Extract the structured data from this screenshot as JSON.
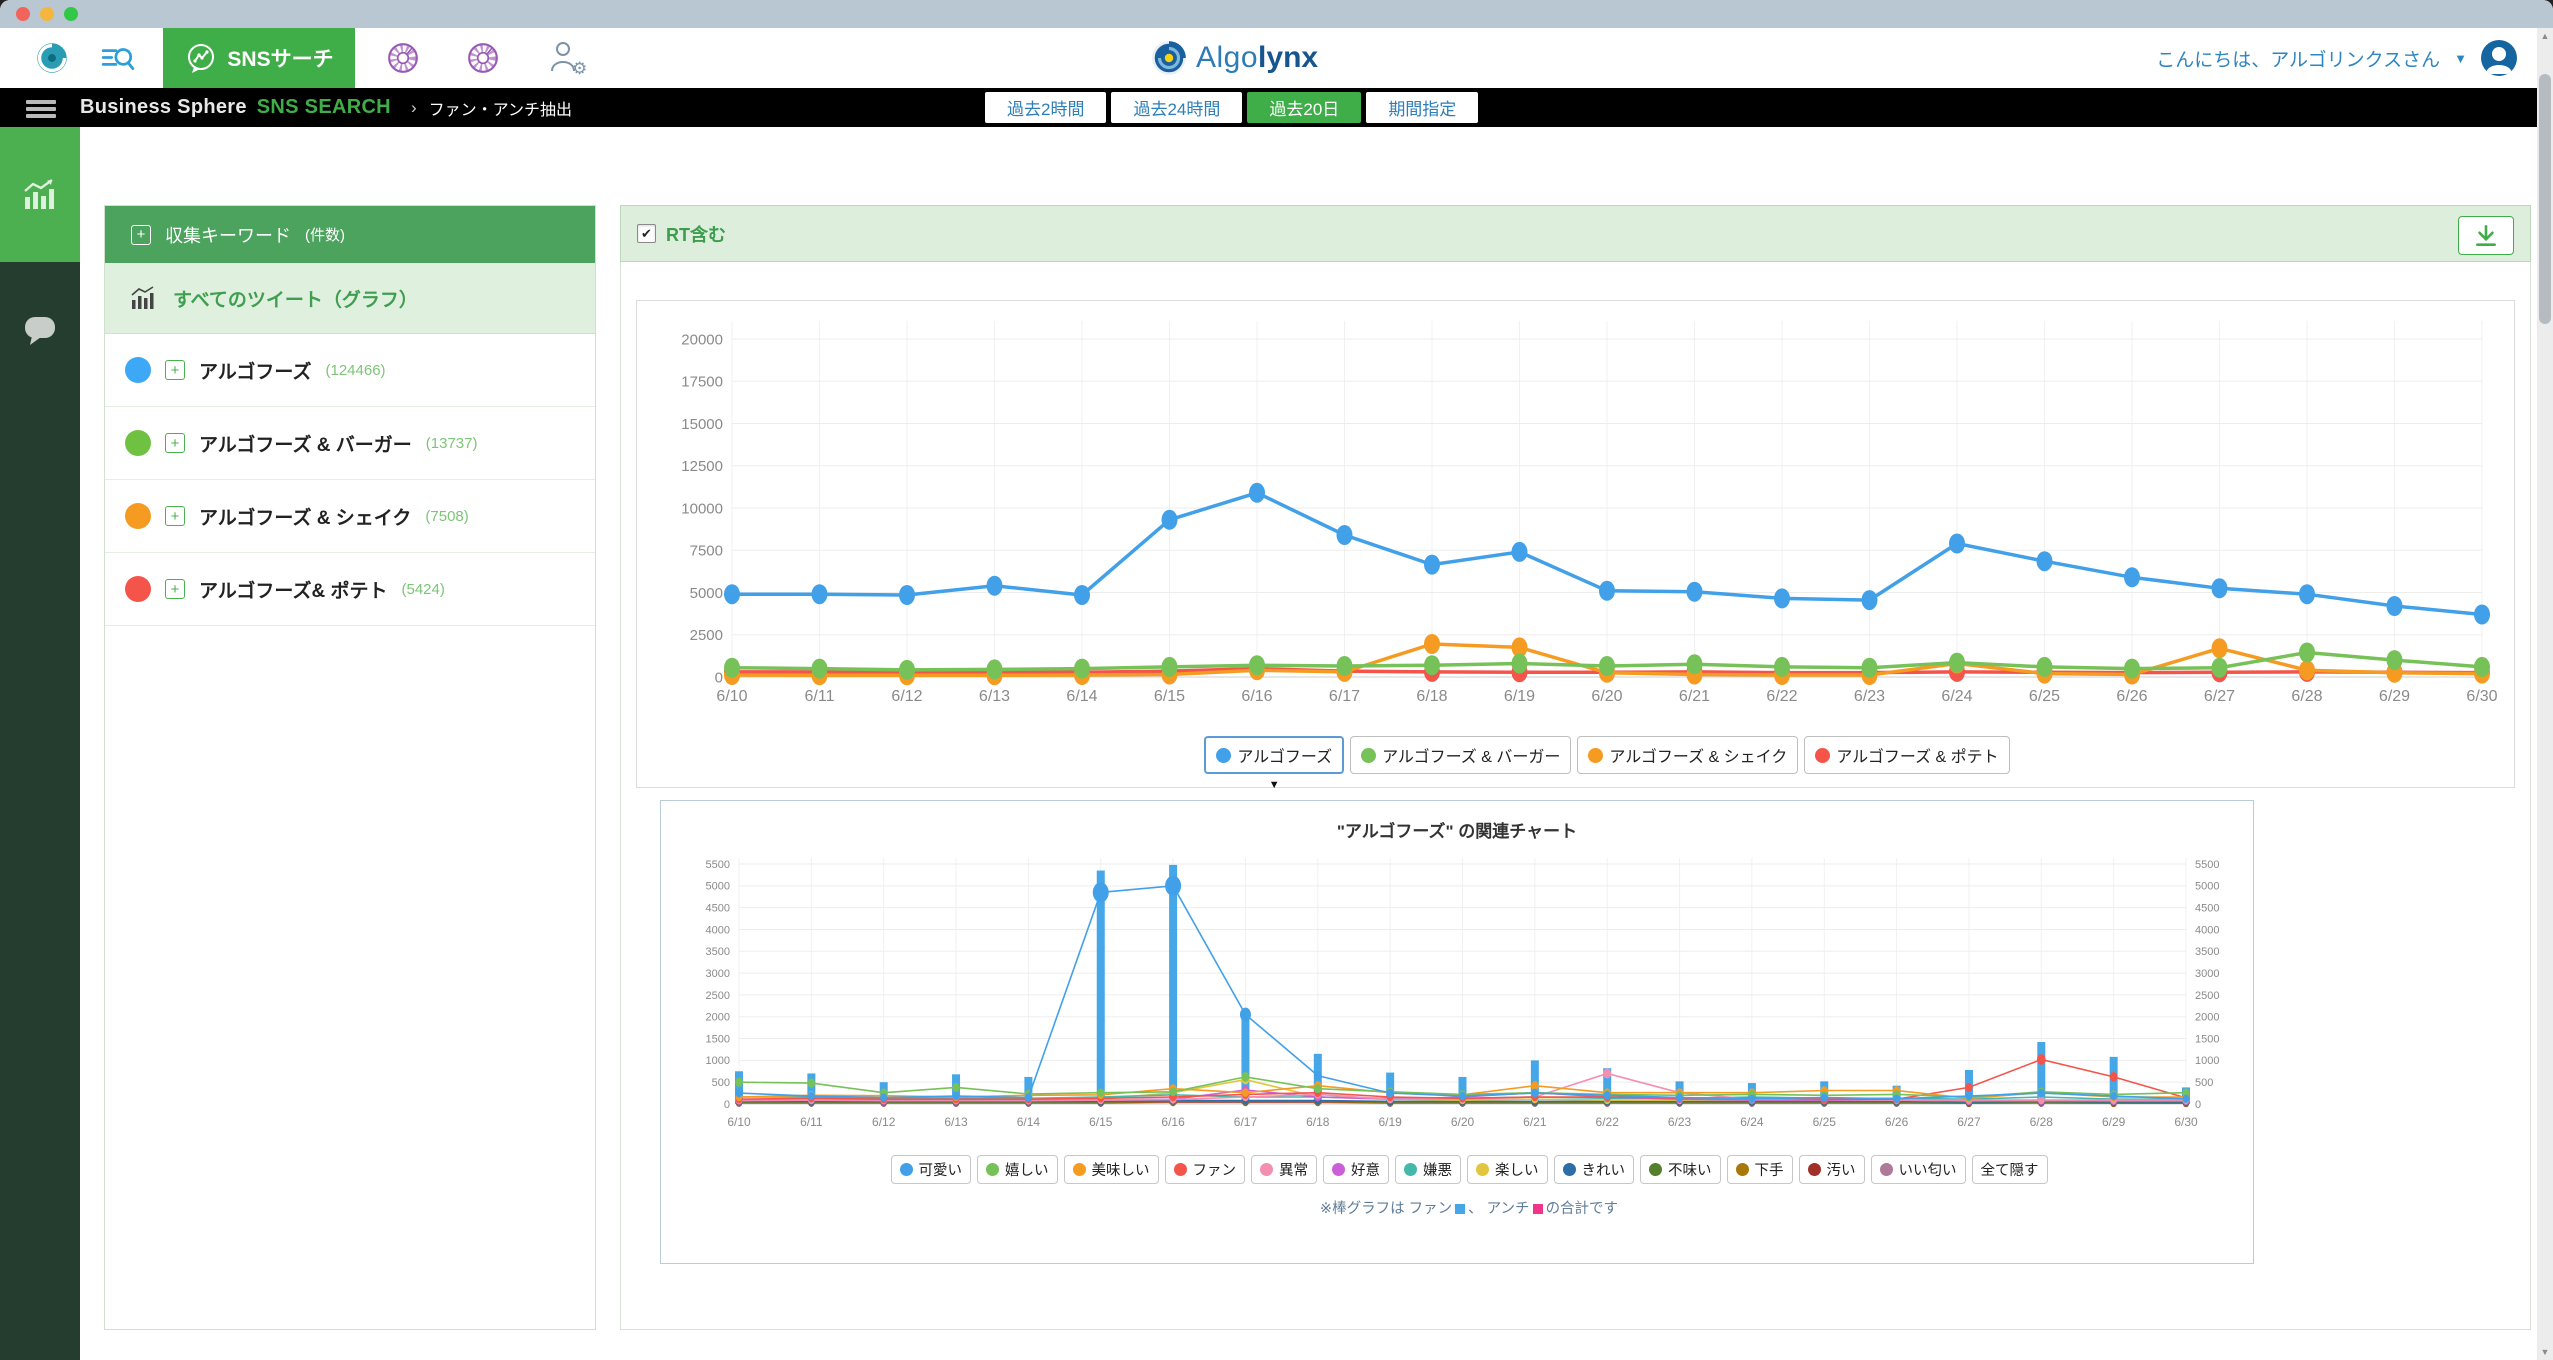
{
  "icons": {
    "plus": "+",
    "check": "✔",
    "caret_down": "▼",
    "scroll_up": "▲",
    "scroll_down": "▼",
    "selected_marker": "▼"
  },
  "navbar": {
    "tab_label": "SNSサーチ",
    "logo_algo": "Algo",
    "logo_lynx": "lynx",
    "greeting": "こんにちは、アルゴリンクスさん"
  },
  "blackbar": {
    "brand_left": "Business Sphere",
    "brand_right": "SNS SEARCH",
    "crumb_sep": "›",
    "breadcrumb": "ファン・アンチ抽出",
    "time_buttons": [
      {
        "label": "過去2時間",
        "active": false
      },
      {
        "label": "過去24時間",
        "active": false
      },
      {
        "label": "過去20日",
        "active": true
      },
      {
        "label": "期間指定",
        "active": false
      }
    ]
  },
  "sidebar": {
    "header_label": "収集キーワード",
    "header_suffix": "(件数)",
    "all_tweets_label": "すべてのツイート（グラフ）",
    "keywords": [
      {
        "label": "アルゴフーズ",
        "count": "(124466)",
        "color": "#3da8f5"
      },
      {
        "label": "アルゴフーズ & バーガー",
        "count": "(13737)",
        "color": "#6fc142"
      },
      {
        "label": "アルゴフーズ & シェイク",
        "count": "(7508)",
        "color": "#f59b22"
      },
      {
        "label": "アルゴフーズ& ポテト",
        "count": "(5424)",
        "color": "#f4544a"
      }
    ]
  },
  "toolbar": {
    "rt_label": "RT含む",
    "rt_checked": true
  },
  "colors": {
    "accent_green": "#3fae49",
    "link_blue": "#2e86c1",
    "fan_square": "#45a7e8",
    "anti_square": "#f0368b"
  },
  "chart_data": [
    {
      "type": "line",
      "title": "",
      "categories": [
        "6/10",
        "6/11",
        "6/12",
        "6/13",
        "6/14",
        "6/15",
        "6/16",
        "6/17",
        "6/18",
        "6/19",
        "6/20",
        "6/21",
        "6/22",
        "6/23",
        "6/24",
        "6/25",
        "6/26",
        "6/27",
        "6/28",
        "6/29",
        "6/30"
      ],
      "ylim": [
        0,
        20000
      ],
      "ystep": 2500,
      "legend_position": "bottom",
      "grid": true,
      "series": [
        {
          "name": "アルゴフーズ",
          "color": "#41a0e8",
          "selected": true,
          "values": [
            4900,
            4900,
            4850,
            5400,
            4850,
            9300,
            10900,
            8400,
            6650,
            7400,
            5100,
            5050,
            4650,
            4550,
            7900,
            6850,
            5900,
            5250,
            4900,
            4200,
            3700
          ]
        },
        {
          "name": "アルゴフーズ & バーガー",
          "color": "#77c159",
          "selected": false,
          "values": [
            550,
            500,
            420,
            450,
            500,
            600,
            700,
            650,
            700,
            800,
            650,
            750,
            600,
            550,
            850,
            600,
            500,
            550,
            1450,
            1000,
            600
          ]
        },
        {
          "name": "アルゴフーズ & シェイク",
          "color": "#f59b22",
          "selected": false,
          "values": [
            120,
            100,
            100,
            100,
            120,
            150,
            400,
            300,
            1950,
            1750,
            250,
            150,
            120,
            120,
            800,
            200,
            150,
            1700,
            400,
            250,
            200
          ]
        },
        {
          "name": "アルゴフーズ & ポテト",
          "color": "#f4544a",
          "selected": false,
          "values": [
            300,
            300,
            300,
            280,
            280,
            350,
            500,
            350,
            300,
            280,
            280,
            300,
            260,
            260,
            300,
            280,
            260,
            280,
            300,
            280,
            260
          ]
        }
      ]
    },
    {
      "type": "bar+line",
      "title": "\"アルゴフーズ\" の関連チャート",
      "categories": [
        "6/10",
        "6/11",
        "6/12",
        "6/13",
        "6/14",
        "6/15",
        "6/16",
        "6/17",
        "6/18",
        "6/19",
        "6/20",
        "6/21",
        "6/22",
        "6/23",
        "6/24",
        "6/25",
        "6/26",
        "6/27",
        "6/28",
        "6/29",
        "6/30"
      ],
      "ylim": [
        0,
        5500
      ],
      "ystep": 500,
      "grid": true,
      "legend_position": "bottom",
      "bars": {
        "name": "ファン・アンチ合計",
        "color": "#45a7e8",
        "values": [
          750,
          700,
          500,
          680,
          620,
          5350,
          5480,
          2050,
          1150,
          720,
          620,
          1000,
          820,
          520,
          480,
          520,
          420,
          780,
          1420,
          1080,
          380
        ]
      },
      "series": [
        {
          "name": "可愛い",
          "color": "#41a0e8",
          "values": [
            250,
            180,
            150,
            180,
            150,
            4850,
            5000,
            2050,
            650,
            250,
            180,
            250,
            200,
            150,
            120,
            150,
            120,
            180,
            250,
            180,
            120
          ]
        },
        {
          "name": "嬉しい",
          "color": "#77c159",
          "values": [
            500,
            480,
            260,
            380,
            230,
            260,
            280,
            620,
            350,
            280,
            220,
            260,
            220,
            200,
            220,
            200,
            220,
            160,
            280,
            220,
            260
          ]
        },
        {
          "name": "美味しい",
          "color": "#f59b22",
          "values": [
            160,
            200,
            190,
            160,
            200,
            210,
            350,
            260,
            420,
            260,
            210,
            420,
            260,
            260,
            260,
            310,
            310,
            130,
            260,
            160,
            160
          ]
        },
        {
          "name": "ファン",
          "color": "#f4544a",
          "values": [
            110,
            130,
            110,
            110,
            110,
            130,
            160,
            220,
            260,
            160,
            130,
            160,
            160,
            140,
            130,
            110,
            110,
            380,
            1020,
            620,
            140
          ]
        },
        {
          "name": "異常",
          "color": "#f48fb1",
          "values": [
            90,
            90,
            90,
            90,
            90,
            90,
            100,
            160,
            220,
            110,
            110,
            160,
            700,
            260,
            110,
            110,
            90,
            90,
            90,
            90,
            90
          ]
        },
        {
          "name": "好意",
          "color": "#cb5fd6",
          "values": [
            70,
            90,
            70,
            70,
            70,
            90,
            110,
            320,
            160,
            110,
            160,
            260,
            160,
            110,
            90,
            90,
            90,
            70,
            70,
            70,
            70
          ]
        },
        {
          "name": "嫌悪",
          "color": "#45b8ac",
          "values": [
            160,
            160,
            130,
            130,
            130,
            160,
            210,
            160,
            160,
            130,
            130,
            160,
            130,
            130,
            160,
            130,
            130,
            110,
            160,
            110,
            110
          ]
        },
        {
          "name": "楽しい",
          "color": "#e3c63e",
          "values": [
            90,
            90,
            90,
            90,
            90,
            110,
            260,
            560,
            160,
            110,
            90,
            110,
            90,
            90,
            90,
            90,
            90,
            70,
            90,
            70,
            70
          ]
        },
        {
          "name": "きれい",
          "color": "#2d6da8",
          "values": [
            60,
            60,
            60,
            60,
            60,
            60,
            80,
            80,
            80,
            60,
            60,
            60,
            60,
            60,
            60,
            60,
            60,
            50,
            60,
            50,
            50
          ]
        },
        {
          "name": "不味い",
          "color": "#557f2d",
          "values": [
            50,
            50,
            50,
            50,
            50,
            50,
            70,
            70,
            70,
            50,
            50,
            50,
            50,
            50,
            50,
            50,
            50,
            40,
            50,
            40,
            40
          ]
        },
        {
          "name": "下手",
          "color": "#a8790a",
          "values": [
            40,
            40,
            40,
            40,
            40,
            40,
            60,
            60,
            60,
            40,
            40,
            40,
            40,
            40,
            40,
            40,
            40,
            30,
            40,
            30,
            30
          ]
        },
        {
          "name": "汚い",
          "color": "#a03028",
          "values": [
            30,
            30,
            30,
            30,
            30,
            30,
            50,
            50,
            50,
            30,
            30,
            30,
            30,
            30,
            30,
            30,
            30,
            20,
            30,
            20,
            20
          ]
        },
        {
          "name": "いい匂い",
          "color": "#ad7a99",
          "values": [
            25,
            25,
            25,
            25,
            25,
            25,
            40,
            40,
            40,
            25,
            25,
            25,
            25,
            25,
            25,
            25,
            25,
            20,
            25,
            20,
            20
          ]
        }
      ],
      "legend_extra": {
        "label": "全て隠す"
      },
      "footnote": {
        "t1": "※棒グラフは ファン",
        "t2": "、 アンチ",
        "t3": "の合計です"
      }
    }
  ]
}
